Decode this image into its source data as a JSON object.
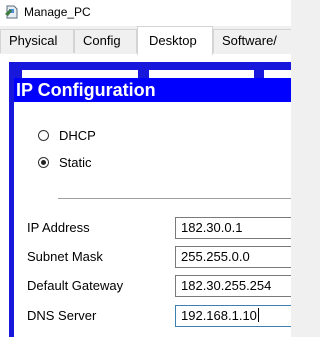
{
  "window": {
    "title": "Manage_PC",
    "icon": "pc-icon"
  },
  "tabs": [
    {
      "label": "Physical",
      "active": false
    },
    {
      "label": "Config",
      "active": false
    },
    {
      "label": "Desktop",
      "active": true
    },
    {
      "label": "Software/",
      "active": false
    }
  ],
  "ip_config": {
    "title": "IP Configuration",
    "mode_options": [
      {
        "label": "DHCP",
        "selected": false
      },
      {
        "label": "Static",
        "selected": true
      }
    ],
    "fields": [
      {
        "label": "IP Address",
        "value": "182.30.0.1"
      },
      {
        "label": "Subnet Mask",
        "value": "255.255.0.0"
      },
      {
        "label": "Default Gateway",
        "value": "182.30.255.254"
      },
      {
        "label": "DNS Server",
        "value": "192.168.1.10"
      }
    ]
  },
  "colors": {
    "header_blue": "#0000ff",
    "frame_blue": "#1818dc",
    "focus_border": "#3c7fb1"
  }
}
